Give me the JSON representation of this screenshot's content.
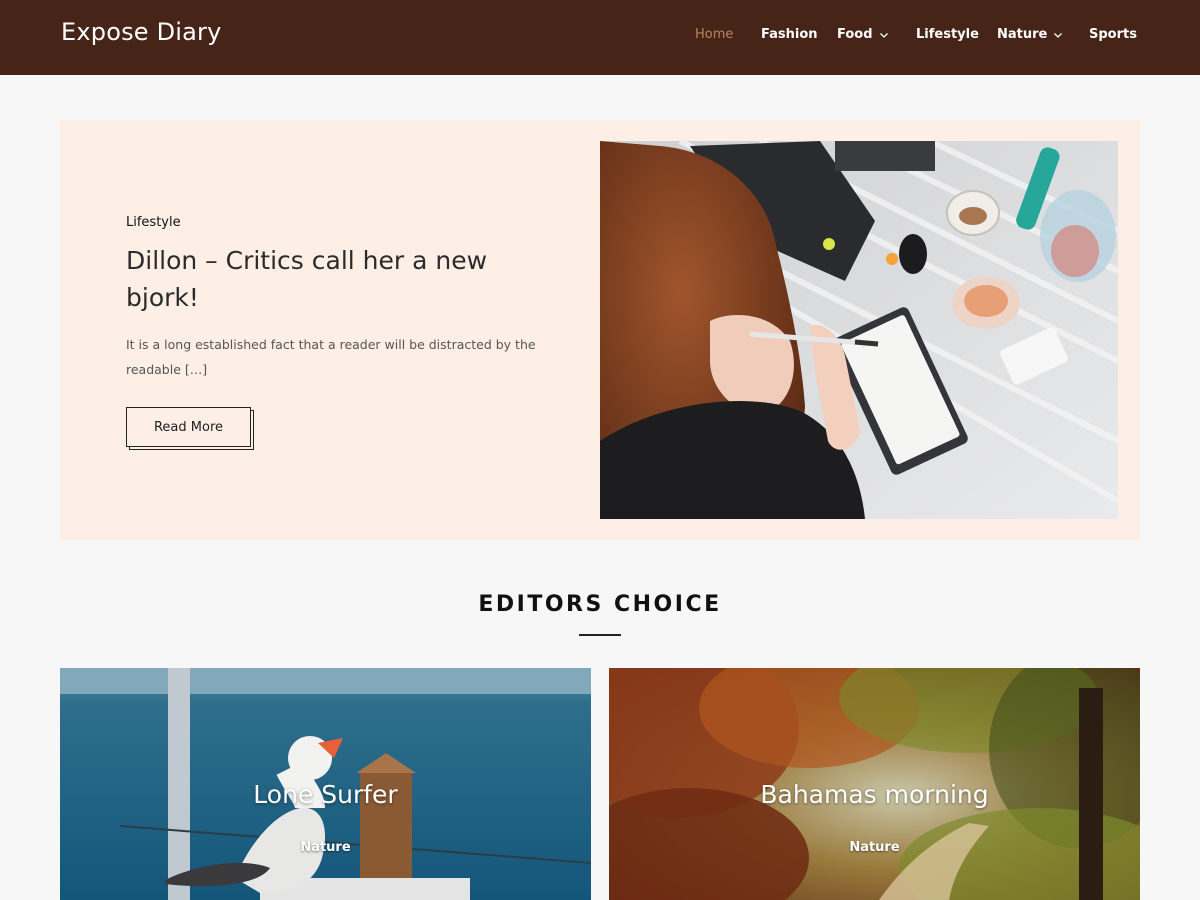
{
  "site": {
    "title": "Expose Diary"
  },
  "nav": {
    "items": [
      {
        "label": "Home",
        "active": true,
        "dropdown": false
      },
      {
        "label": "Fashion",
        "active": false,
        "dropdown": false
      },
      {
        "label": "Food",
        "active": false,
        "dropdown": true
      },
      {
        "label": "Lifestyle",
        "active": false,
        "dropdown": false
      },
      {
        "label": "Nature",
        "active": false,
        "dropdown": true
      },
      {
        "label": "Sports",
        "active": false,
        "dropdown": false
      }
    ]
  },
  "hero": {
    "category": "Lifestyle",
    "title": "Dillon – Critics call her a new bjork!",
    "excerpt": "It is a long established fact that a reader will be distracted by the readable […]",
    "button_label": "Read More",
    "image_icon": "woman-writing-photo"
  },
  "editors_choice": {
    "heading": "EDITORS CHOICE",
    "cards": [
      {
        "title": "Lone Surfer",
        "category": "Nature",
        "image_icon": "seagull-photo"
      },
      {
        "title": "Bahamas morning",
        "category": "Nature",
        "image_icon": "autumn-forest-photo"
      }
    ]
  },
  "colors": {
    "header_bg": "#472418",
    "nav_active": "#b8855b",
    "hero_bg": "#fdeee6",
    "page_bg": "#f7f7f7"
  }
}
